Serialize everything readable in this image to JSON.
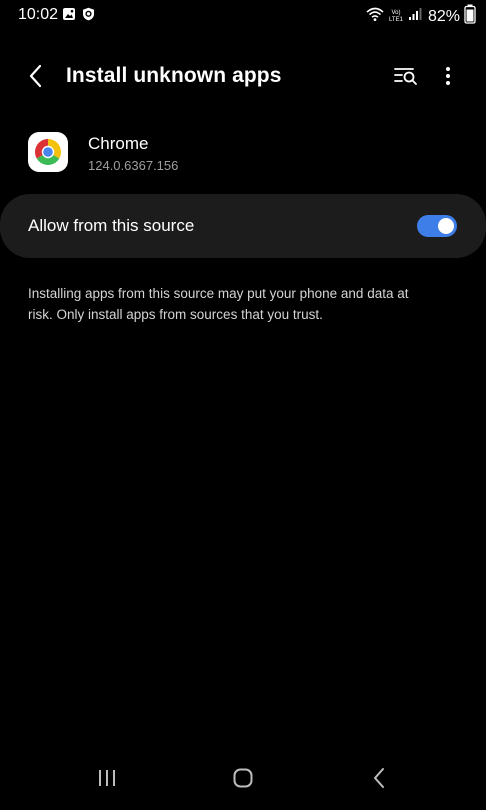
{
  "status_bar": {
    "time": "10:02",
    "battery_percent": "82%",
    "network_top": "Vo)",
    "network_bottom": "LTE1",
    "left_icons": [
      "gallery-icon",
      "shield-icon"
    ],
    "right_icons": [
      "wifi-icon",
      "signal-icon"
    ]
  },
  "toolbar": {
    "title": "Install unknown apps",
    "back_icon": "chevron-left-icon",
    "search_icon": "search-settings-icon",
    "more_icon": "more-vertical-icon"
  },
  "app": {
    "name": "Chrome",
    "version": "124.0.6367.156",
    "icon": "chrome-icon"
  },
  "allow_row": {
    "label": "Allow from this source",
    "enabled": true
  },
  "warning": {
    "text": "Installing apps from this source may put your phone and data at risk. Only install apps from sources that you trust."
  },
  "nav_bar": {
    "icons": [
      "recents-icon",
      "home-icon",
      "back-icon"
    ]
  },
  "colors": {
    "background": "#000000",
    "row_background": "#1c1c1c",
    "toggle_on": "#3e7ee8",
    "secondary_text": "#9e9e9e"
  }
}
